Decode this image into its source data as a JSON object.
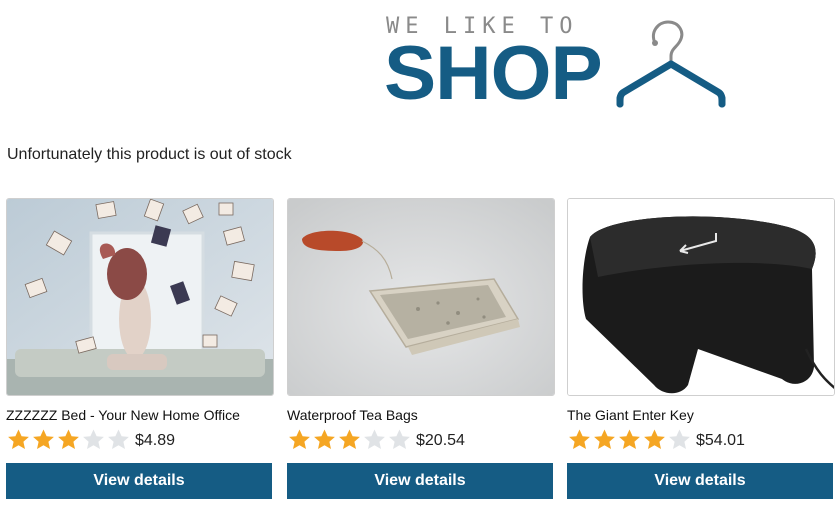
{
  "header": {
    "tagline": "WE LIKE TO",
    "brand": "SHOP",
    "hanger_icon": "hanger-icon",
    "brand_color": "#155c84",
    "tagline_color": "#8a8a8a"
  },
  "notice": "Unfortunately this product is out of stock",
  "products": [
    {
      "name": "ZZZZZZ Bed - Your New Home Office",
      "rating": 3,
      "max_rating": 5,
      "price": "$4.89",
      "button": "View details"
    },
    {
      "name": "Waterproof Tea Bags",
      "rating": 3,
      "max_rating": 5,
      "price": "$20.54",
      "button": "View details"
    },
    {
      "name": "The Giant Enter Key",
      "rating": 4,
      "max_rating": 5,
      "price": "$54.01",
      "button": "View details"
    }
  ],
  "colors": {
    "star_filled": "#f5a623",
    "star_empty": "#e0e3e6",
    "button_bg": "#155c84"
  }
}
